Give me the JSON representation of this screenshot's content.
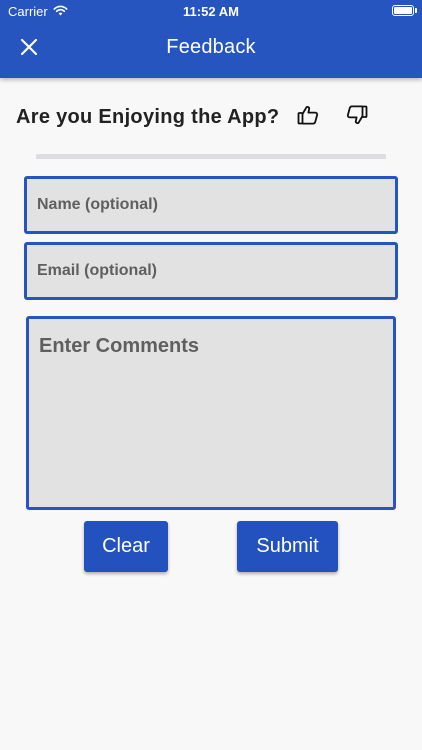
{
  "status_bar": {
    "carrier": "Carrier",
    "time": "11:52 AM"
  },
  "nav": {
    "title": "Feedback",
    "close_icon": "close-icon"
  },
  "question": {
    "text": "Are you Enjoying the App?",
    "thumbs_up_icon": "thumbs-up-icon",
    "thumbs_down_icon": "thumbs-down-icon"
  },
  "form": {
    "name_placeholder": "Name (optional)",
    "email_placeholder": "Email (optional)",
    "comments_placeholder": "Enter Comments"
  },
  "buttons": {
    "clear_label": "Clear",
    "submit_label": "Submit"
  },
  "colors": {
    "accent": "#2655c0",
    "field_bg": "#e2e2e2",
    "page_bg": "#f8f8f8"
  }
}
